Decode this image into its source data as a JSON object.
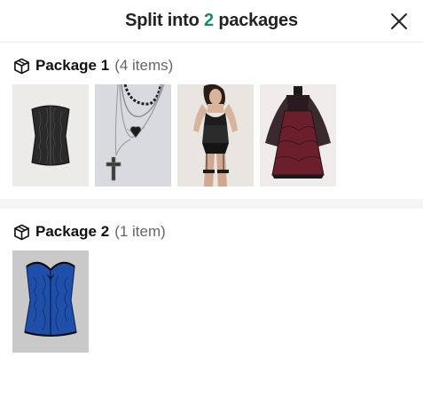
{
  "header": {
    "title_prefix": "Split into",
    "title_count": "2",
    "title_suffix": "packages",
    "accent_color": "#1a8a6b",
    "close_icon": "close-icon"
  },
  "packages": [
    {
      "name": "Package 1",
      "count": "(4 items)",
      "icon": "package-box-icon",
      "items": [
        {
          "image": "black-jacquard-corset"
        },
        {
          "image": "layered-gothic-necklace-with-cross"
        },
        {
          "image": "black-lace-lingerie-set"
        },
        {
          "image": "black-red-lace-bell-sleeve-dress"
        }
      ]
    },
    {
      "name": "Package 2",
      "count": "(1 item)",
      "icon": "package-box-icon",
      "items": [
        {
          "image": "blue-brocade-corset"
        }
      ]
    }
  ]
}
